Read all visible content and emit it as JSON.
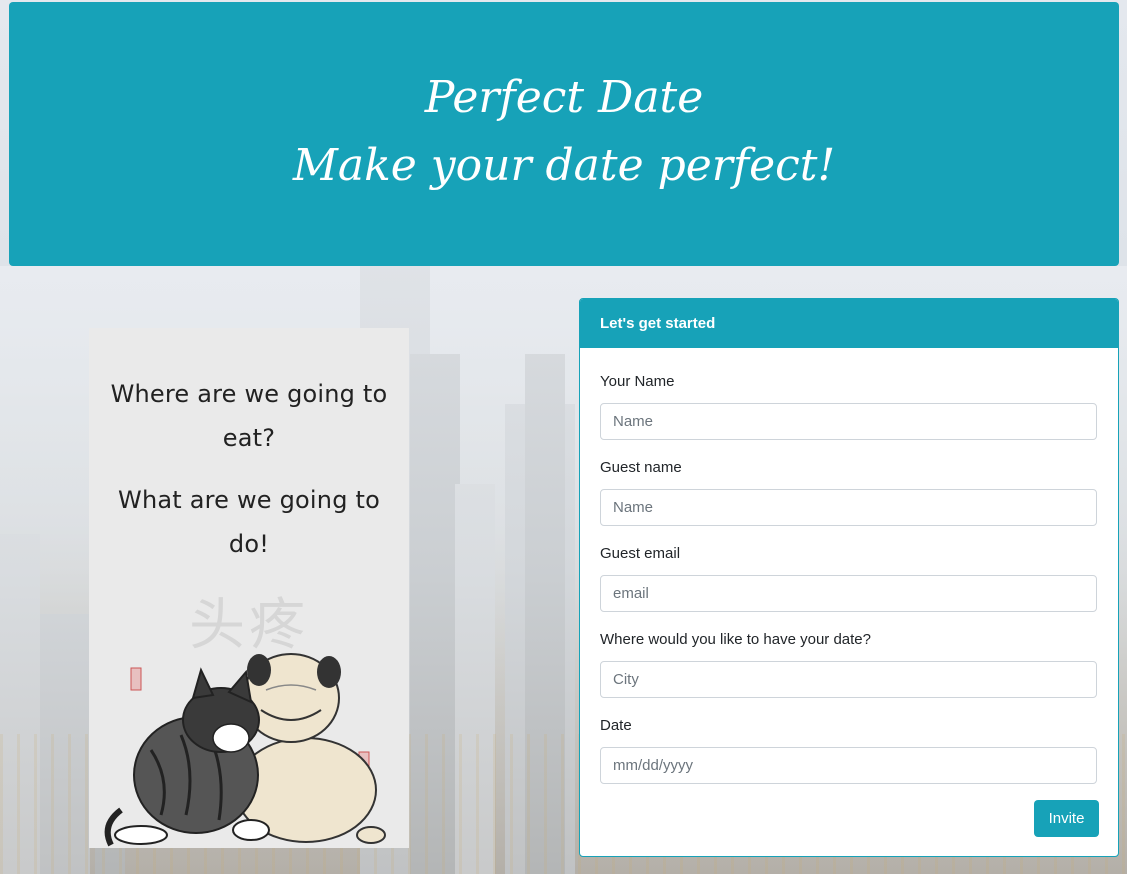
{
  "header": {
    "title": "Perfect Date",
    "subtitle": "Make your date perfect!"
  },
  "left_card": {
    "question_1": "Where are we going to eat?",
    "question_2": "What are we going to do!",
    "image_caption": "头疼"
  },
  "form": {
    "heading": "Let's get started",
    "fields": [
      {
        "label": "Your Name",
        "placeholder": "Name"
      },
      {
        "label": "Guest name",
        "placeholder": "Name"
      },
      {
        "label": "Guest email",
        "placeholder": "email"
      },
      {
        "label": "Where would you like to have your date?",
        "placeholder": "City"
      },
      {
        "label": "Date",
        "placeholder": "mm/dd/yyyy"
      }
    ],
    "submit_label": "Invite"
  },
  "colors": {
    "accent": "#17a2b8",
    "card_bg": "#eaeaea"
  }
}
